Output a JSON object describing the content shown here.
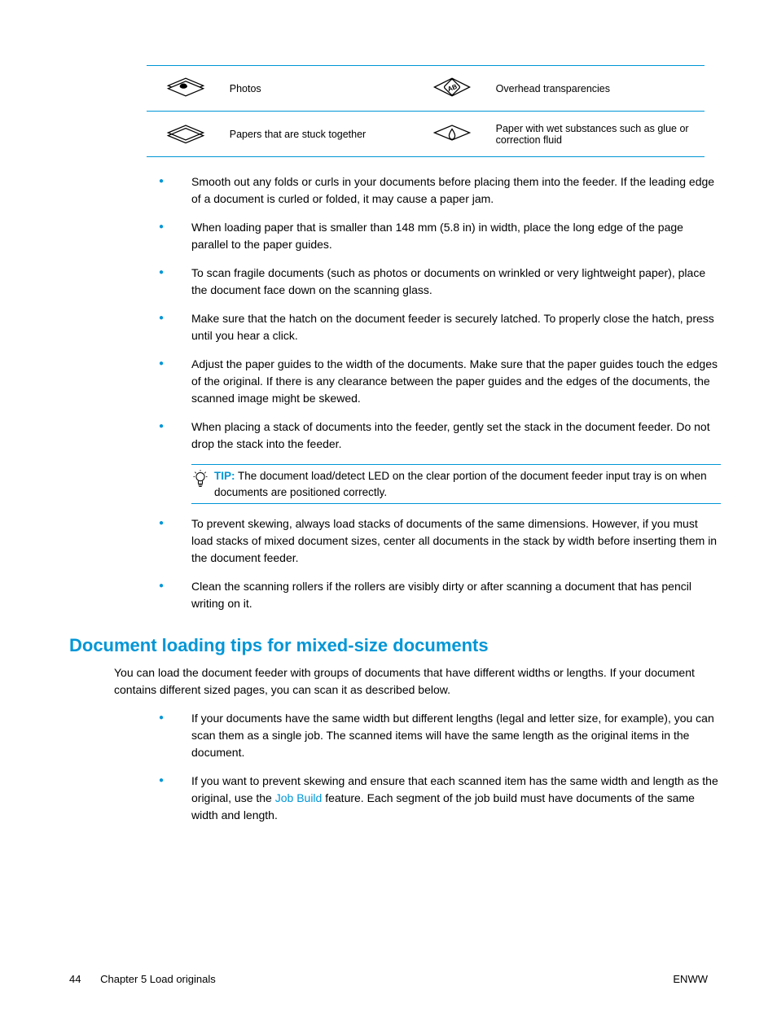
{
  "table": {
    "rows": [
      {
        "icon1": "photos-icon",
        "label1": "Photos",
        "icon2": "transparency-icon",
        "label2": "Overhead transparencies"
      },
      {
        "icon1": "stuck-icon",
        "label1": "Papers that are stuck together",
        "icon2": "wet-icon",
        "label2": "Paper with wet substances such as glue or correction fluid"
      }
    ]
  },
  "bullets1": [
    "Smooth out any folds or curls in your documents before placing them into the feeder. If the leading edge of a document is curled or folded, it may cause a paper jam.",
    "When loading paper that is smaller than 148 mm (5.8 in) in width, place the long edge of the page parallel to the paper guides.",
    "To scan fragile documents (such as photos or documents on wrinkled or very lightweight paper), place the document face down on the scanning glass.",
    "Make sure that the hatch on the document feeder is securely latched. To properly close the hatch, press until you hear a click.",
    "Adjust the paper guides to the width of the documents. Make sure that the paper guides touch the edges of the original. If there is any clearance between the paper guides and the edges of the documents, the scanned image might be skewed.",
    "When placing a stack of documents into the feeder, gently set the stack in the document feeder. Do not drop the stack into the feeder."
  ],
  "tip": {
    "label": "TIP:",
    "text": "The document load/detect LED on the clear portion of the document feeder input tray is on when documents are positioned correctly."
  },
  "bullets1b": [
    "To prevent skewing, always load stacks of documents of the same dimensions. However, if you must load stacks of mixed document sizes, center all documents in the stack by width before inserting them in the document feeder.",
    "Clean the scanning rollers if the rollers are visibly dirty or after scanning a document that has pencil writing on it."
  ],
  "heading": "Document loading tips for mixed-size documents",
  "section_para": "You can load the document feeder with groups of documents that have different widths or lengths. If your document contains different sized pages, you can scan it as described below.",
  "bullets2": [
    {
      "text": "If your documents have the same width but different lengths (legal and letter size, for example), you can scan them as a single job. The scanned items will have the same length as the original items in the document."
    },
    {
      "pre": "If you want to prevent skewing and ensure that each scanned item has the same width and length as the original, use the ",
      "link": "Job Build",
      "post": " feature. Each segment of the job build must have documents of the same width and length."
    }
  ],
  "footer": {
    "page": "44",
    "chapter": "Chapter 5   Load originals",
    "right": "ENWW"
  }
}
